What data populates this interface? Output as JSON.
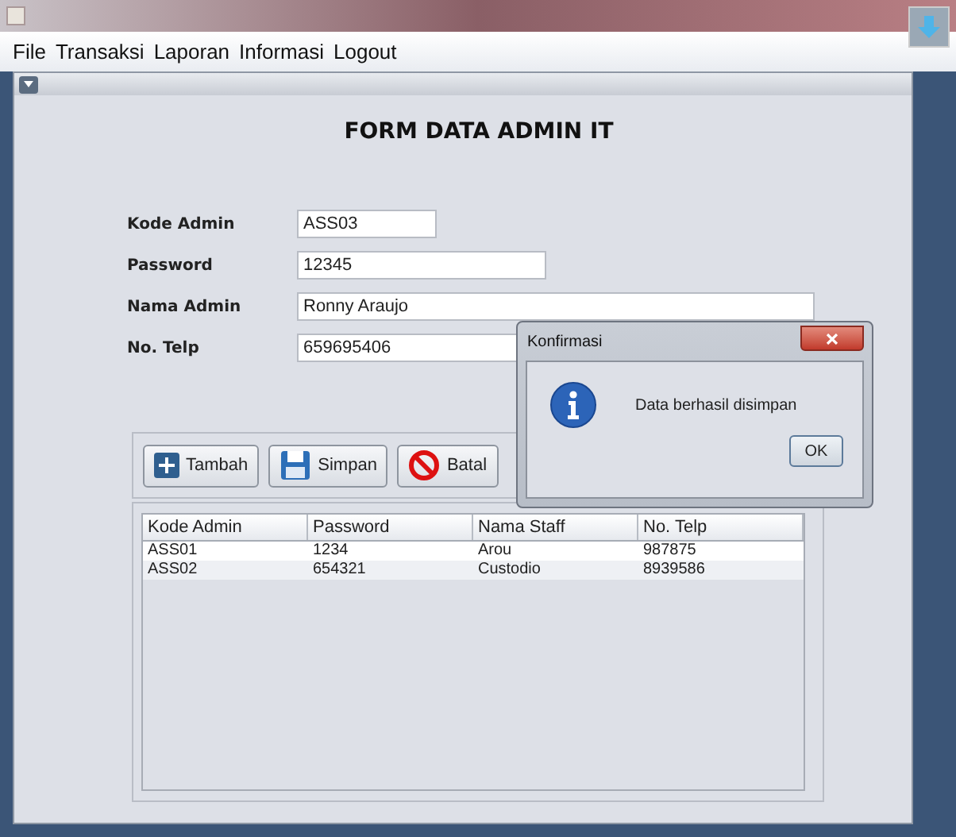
{
  "menu": [
    "File",
    "Transaksi",
    "Laporan",
    "Informasi",
    "Logout"
  ],
  "form": {
    "title": "FORM DATA ADMIN IT",
    "fields": [
      {
        "label": "Kode Admin",
        "value": "ASS03"
      },
      {
        "label": "Password",
        "value": "12345"
      },
      {
        "label": "Nama Admin",
        "value": "Ronny Araujo"
      },
      {
        "label": "No. Telp",
        "value": "659695406"
      }
    ]
  },
  "buttons": [
    {
      "label": "Tambah",
      "kind": "add"
    },
    {
      "label": "Simpan",
      "kind": "save"
    },
    {
      "label": "Batal",
      "kind": "cancel"
    }
  ],
  "table": {
    "columns": [
      "Kode Admin",
      "Password",
      "Nama Staff",
      "No. Telp"
    ],
    "rows": [
      [
        "ASS01",
        "1234",
        "Arou",
        "987875"
      ],
      [
        "ASS02",
        "654321",
        "Custodio",
        "8939586"
      ]
    ]
  },
  "dialog": {
    "title": "Konfirmasi",
    "message": "Data berhasil disimpan",
    "button": "OK"
  }
}
